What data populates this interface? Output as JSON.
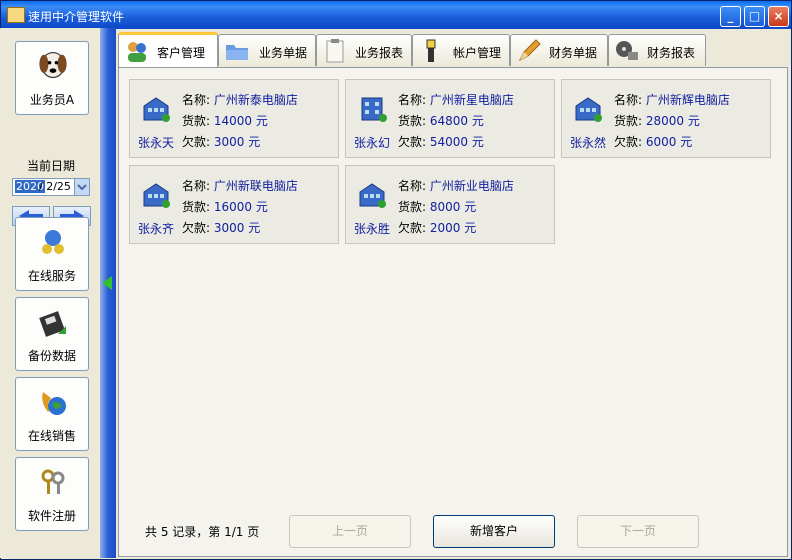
{
  "window": {
    "title": "速用中介管理软件",
    "min": "_",
    "max": "□",
    "close": "×"
  },
  "sidebar": {
    "user_label": "业务员A",
    "date_label": "当前日期",
    "date_selected": "2020",
    "date_rest": "/ 2/25",
    "buttons": [
      {
        "label": "在线服务",
        "icon": "online-service-icon"
      },
      {
        "label": "备份数据",
        "icon": "backup-disk-icon"
      },
      {
        "label": "在线销售",
        "icon": "phone-globe-icon"
      },
      {
        "label": "软件注册",
        "icon": "keys-icon"
      }
    ]
  },
  "tabs": [
    {
      "label": "客户管理",
      "icon": "customers-icon",
      "active": true
    },
    {
      "label": "业务单据",
      "icon": "folder-icon",
      "active": false
    },
    {
      "label": "业务报表",
      "icon": "clipboard-icon",
      "active": false
    },
    {
      "label": "帐户管理",
      "icon": "lamp-tower-icon",
      "active": false
    },
    {
      "label": "财务单据",
      "icon": "pencil-icon",
      "active": false
    },
    {
      "label": "财务报表",
      "icon": "film-reel-icon",
      "active": false
    }
  ],
  "field_labels": {
    "name": "名称:",
    "goods": "货款:",
    "owed": "欠款:"
  },
  "customers": [
    {
      "name": "广州新泰电脑店",
      "goods": "14000 元",
      "person": "张永天",
      "owed": "3000 元"
    },
    {
      "name": "广州新星电脑店",
      "goods": "64800 元",
      "person": "张永幻",
      "owed": "54000 元"
    },
    {
      "name": "广州新辉电脑店",
      "goods": "28000 元",
      "person": "张永然",
      "owed": "6000 元"
    },
    {
      "name": "广州新联电脑店",
      "goods": "16000 元",
      "person": "张永齐",
      "owed": "3000 元"
    },
    {
      "name": "广州新业电脑店",
      "goods": "8000 元",
      "person": "张永胜",
      "owed": "2000 元"
    }
  ],
  "footer": {
    "summary": "共 5 记录，第 1/1 页",
    "prev": "上一页",
    "add": "新增客户",
    "next": "下一页"
  }
}
